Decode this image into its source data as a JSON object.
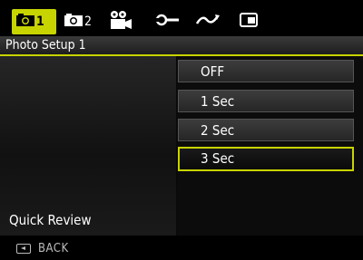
{
  "tabs": [
    {
      "label": "1",
      "icon": "camera-icon",
      "active": true
    },
    {
      "label": "2",
      "icon": "camera-icon",
      "active": false
    },
    {
      "icon": "movie-camera-icon",
      "active": false
    },
    {
      "icon": "wrench-icon",
      "active": false
    },
    {
      "icon": "playback-icon",
      "active": false
    },
    {
      "icon": "memory-card-icon",
      "active": false
    }
  ],
  "header": {
    "title": "Photo Setup 1"
  },
  "menu": {
    "item_label": "Quick Review"
  },
  "options": [
    {
      "label": "OFF",
      "selected": false
    },
    {
      "label": "1 Sec",
      "selected": false
    },
    {
      "label": "2 Sec",
      "selected": false
    },
    {
      "label": "3 Sec",
      "selected": true
    }
  ],
  "footer": {
    "back_label": "BACK"
  },
  "colors": {
    "accent": "#c8d400",
    "background": "#000000"
  }
}
